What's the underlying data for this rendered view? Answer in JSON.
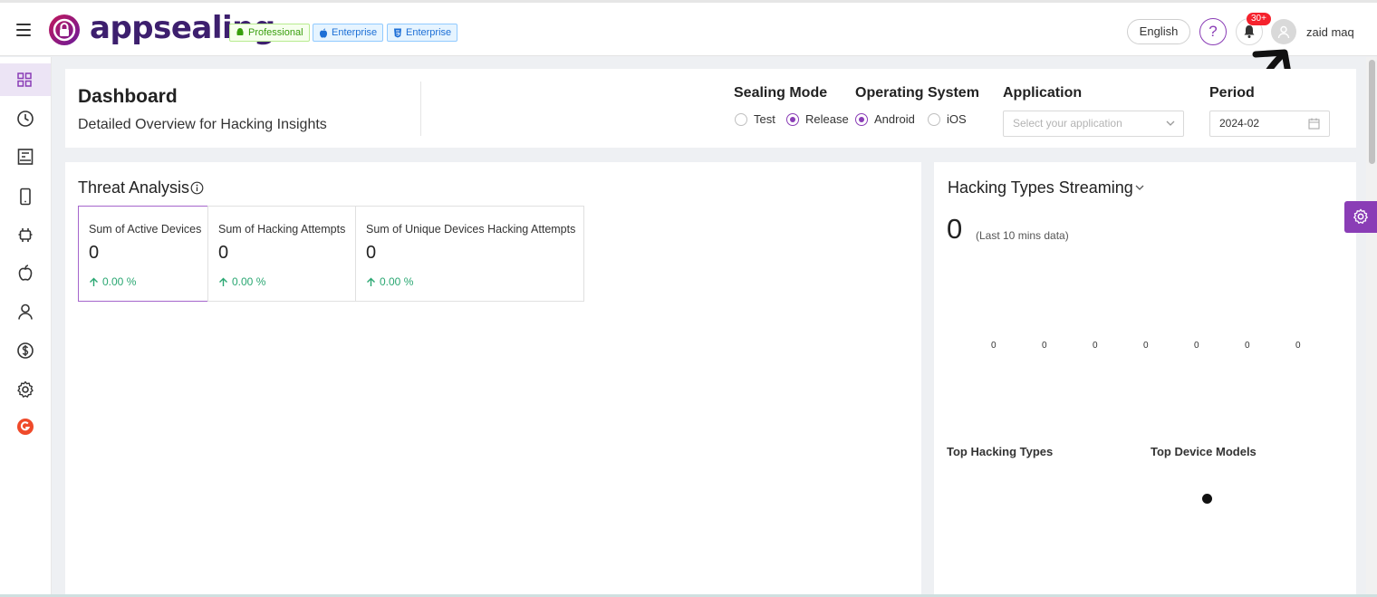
{
  "header": {
    "brand": "appsealing",
    "badges": [
      {
        "label": "Professional",
        "icon": "android-icon",
        "color": "#389e0d"
      },
      {
        "label": "Enterprise",
        "icon": "apple-icon",
        "color": "#1d6fd6"
      },
      {
        "label": "Enterprise",
        "icon": "html5-icon",
        "color": "#1d6fd6"
      }
    ],
    "language": "English",
    "help": "?",
    "notification_count": "30+",
    "username": "zaid maq"
  },
  "sidebar": {
    "items": [
      {
        "icon": "dashboard-grid-icon",
        "active": true
      },
      {
        "icon": "clock-icon"
      },
      {
        "icon": "report-icon"
      },
      {
        "icon": "mobile-icon"
      },
      {
        "icon": "android-icon"
      },
      {
        "icon": "apple-icon"
      },
      {
        "icon": "user-icon"
      },
      {
        "icon": "dollar-icon"
      },
      {
        "icon": "settings-gear-icon"
      },
      {
        "icon": "g2-icon"
      }
    ]
  },
  "filters": {
    "title": "Dashboard",
    "subtitle": "Detailed Overview for Hacking Insights",
    "sealing_mode": {
      "label": "Sealing Mode",
      "options": [
        "Test",
        "Release"
      ],
      "selected": "Release"
    },
    "operating_system": {
      "label": "Operating System",
      "options": [
        "Android",
        "iOS"
      ],
      "selected": "Android"
    },
    "application": {
      "label": "Application",
      "placeholder": "Select your application"
    },
    "period": {
      "label": "Period",
      "value": "2024-02"
    }
  },
  "threat_analysis": {
    "title": "Threat Analysis",
    "stats": [
      {
        "label": "Sum of Active Devices",
        "value": "0",
        "change": "0.00 %"
      },
      {
        "label": "Sum of Hacking Attempts",
        "value": "0",
        "change": "0.00 %"
      },
      {
        "label": "Sum of Unique Devices Hacking Attempts",
        "value": "0",
        "change": "0.00 %"
      }
    ]
  },
  "streaming": {
    "title": "Hacking Types Streaming",
    "value": "0",
    "note": "(Last 10 mins data)",
    "points": [
      "0",
      "0",
      "0",
      "0",
      "0",
      "0",
      "0"
    ],
    "top_hacking_types": "Top Hacking Types",
    "top_device_models": "Top Device Models"
  },
  "colors": {
    "accent": "#8a3db6",
    "brand_text": "#3d1f6e",
    "positive": "#2aa772",
    "notification": "#f5222d"
  }
}
